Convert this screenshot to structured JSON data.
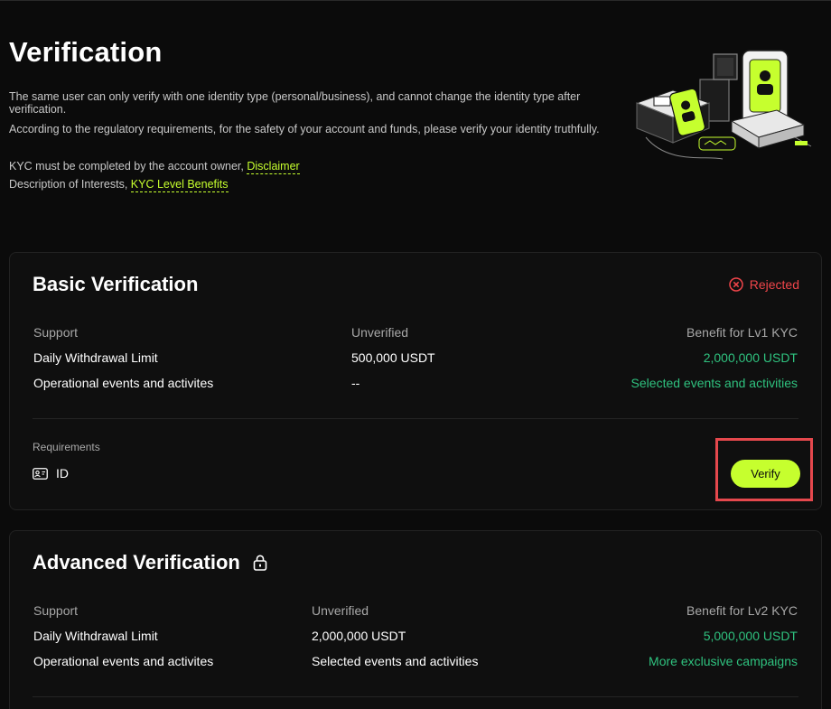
{
  "page": {
    "title": "Verification",
    "intro_line1": "The same user can only verify with one identity type (personal/business), and cannot change the identity type after verification.",
    "intro_line2": "According to the regulatory requirements, for the safety of your account and funds, please verify your identity truthfully.",
    "kyc_owner_text": "KYC must be completed by the account owner,",
    "disclaimer_link": "Disclaimer",
    "interests_text": "Description of Interests,",
    "benefits_link": "KYC Level Benefits"
  },
  "basic": {
    "title": "Basic Verification",
    "status": "Rejected",
    "headers": [
      "Support",
      "Unverified",
      "Benefit for Lv1 KYC"
    ],
    "rows": [
      [
        "Daily Withdrawal Limit",
        "500,000 USDT",
        "2,000,000 USDT"
      ],
      [
        "Operational events and activites",
        "--",
        "Selected events and activities"
      ]
    ],
    "requirements_label": "Requirements",
    "requirement_item": "ID",
    "verify_label": "Verify"
  },
  "advanced": {
    "title": "Advanced Verification",
    "headers": [
      "Support",
      "Unverified",
      "Benefit for Lv2 KYC"
    ],
    "rows": [
      [
        "Daily Withdrawal Limit",
        "2,000,000 USDT",
        "5,000,000 USDT"
      ],
      [
        "Operational events and activites",
        "Selected events and activities",
        "More exclusive campaigns"
      ]
    ]
  },
  "icons": {
    "status": "close-circle-icon",
    "requirement": "id-card-icon",
    "lock": "lock-icon"
  },
  "colors": {
    "accent": "#c6ff2e",
    "benefit": "#2fc27f",
    "rejected": "#f0454a",
    "background": "#0b0b0b"
  }
}
